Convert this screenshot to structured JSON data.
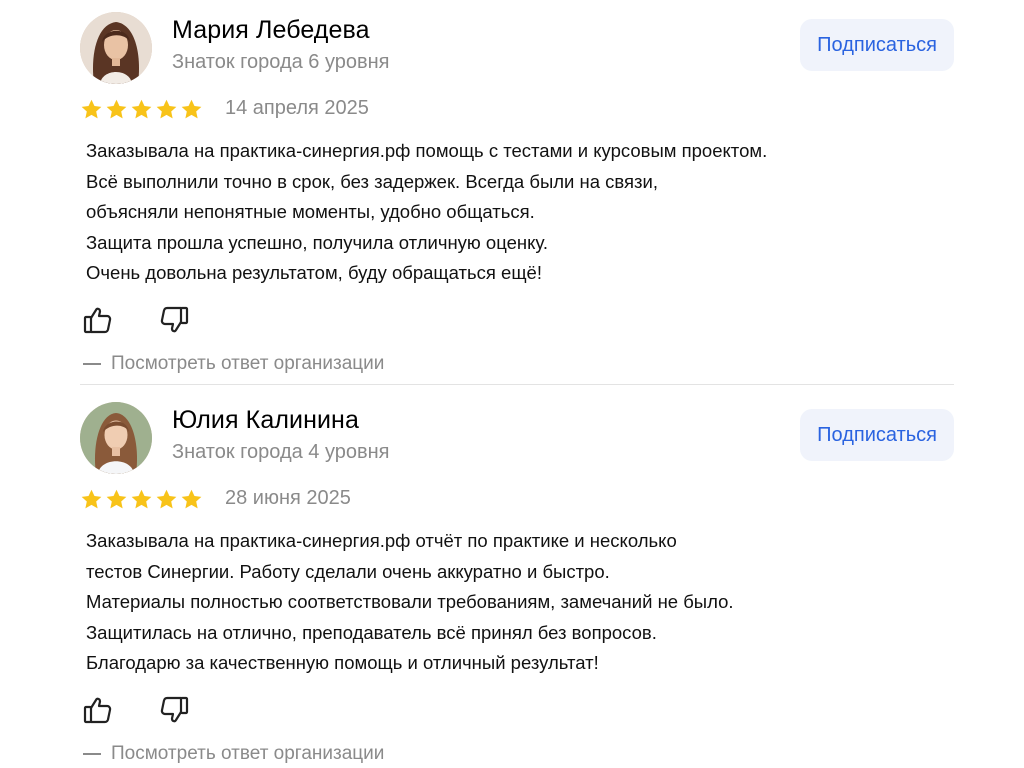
{
  "colors": {
    "accent": "#2a63e0",
    "star": "#f8c319",
    "muted": "#8a8a8a",
    "button_bg": "#f0f3fb"
  },
  "reviews": [
    {
      "author": "Мария Лебедева",
      "level": "Знаток города 6 уровня",
      "subscribe_label": "Подписаться",
      "rating": 5,
      "date": "14 апреля 2025",
      "text_lines": [
        "Заказывала на практика-синергия.рф помощь с тестами и курсовым проектом.",
        "Всё выполнили точно в срок, без задержек. Всегда были на связи,",
        "объясняли непонятные моменты, удобно общаться.",
        "Защита прошла успешно, получила отличную оценку.",
        "Очень довольна результатом, буду обращаться ещё!"
      ],
      "like_icon": "thumbs-up-icon",
      "dislike_icon": "thumbs-down-icon",
      "org_answer_label": "Посмотреть ответ организации"
    },
    {
      "author": "Юлия Калинина",
      "level": "Знаток города 4 уровня",
      "subscribe_label": "Подписаться",
      "rating": 5,
      "date": "28 июня 2025",
      "text_lines": [
        "Заказывала на практика-синергия.рф отчёт по практике и несколько",
        "тестов Синергии. Работу сделали очень аккуратно и быстро.",
        "Материалы полностью соответствовали требованиям, замечаний не было.",
        "Защитилась на отлично, преподаватель всё принял без вопросов.",
        "Благодарю за качественную помощь и отличный результат!"
      ],
      "like_icon": "thumbs-up-icon",
      "dislike_icon": "thumbs-down-icon",
      "org_answer_label": "Посмотреть ответ организации"
    }
  ]
}
